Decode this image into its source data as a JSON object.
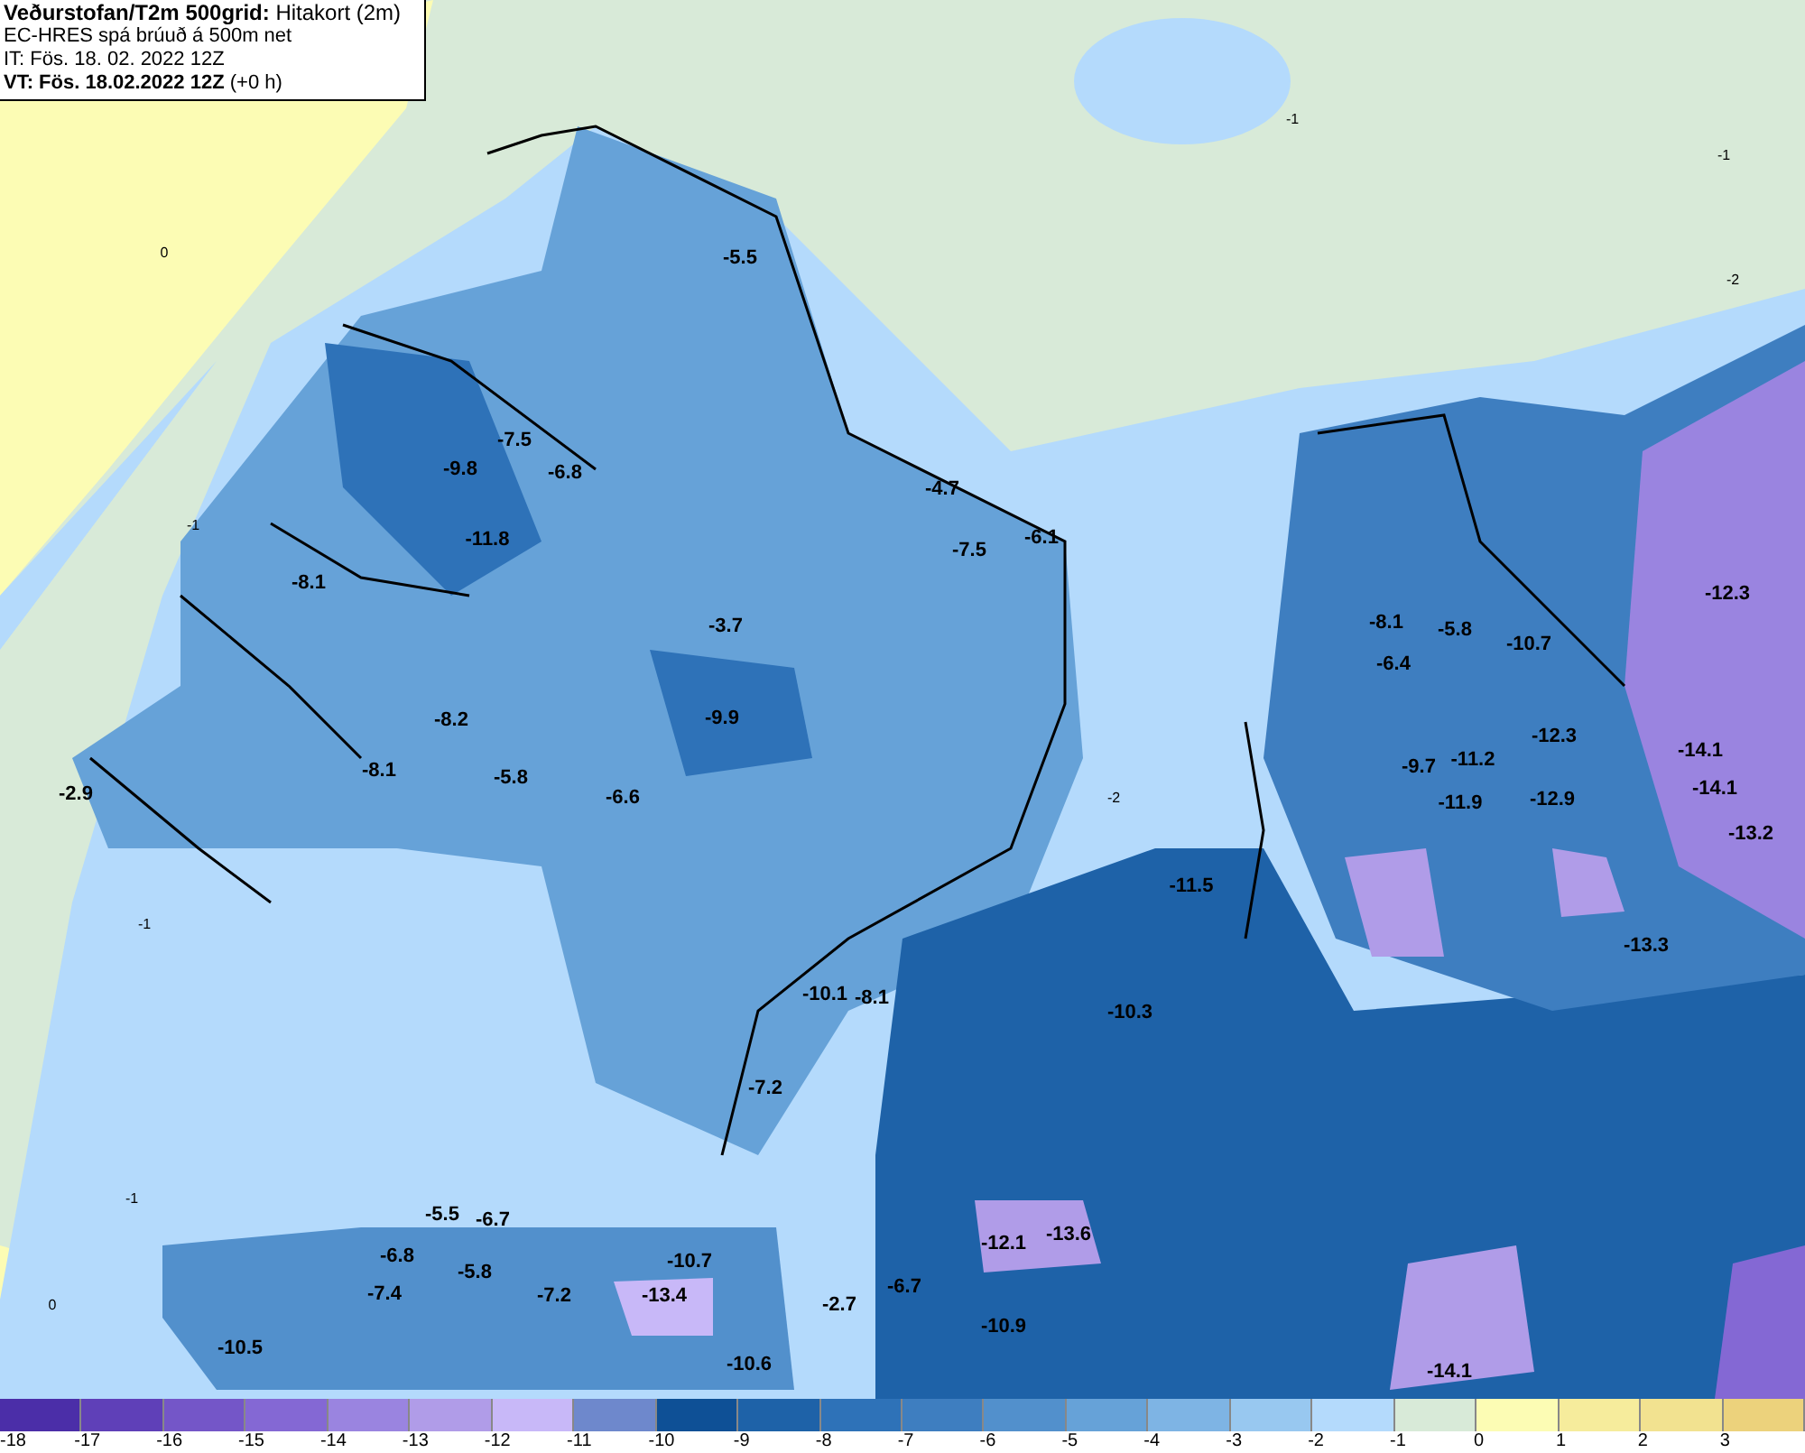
{
  "header": {
    "lines": [
      "**Veðurstofan/T2m 500grid:** Hitakort (2m)",
      "EC-HRES spá brúuð á 500m net",
      "IT: Fös. 18. 02. 2022 12Z",
      "**VT: Fös. 18.02.2022 12Z** (+0 h)"
    ]
  },
  "map": {
    "peak_labels": [
      "-5.5",
      "-7.5",
      "-9.8",
      "-6.8",
      "-11.8",
      "-8.1",
      "-3.7",
      "-4.7",
      "-7.5",
      "-6.1",
      "-8.2",
      "-8.1",
      "-9.9",
      "-2.9",
      "-5.8",
      "-6.6",
      "-11.5",
      "-10.1",
      "-8.1",
      "-10.3",
      "-7.2",
      "-8.1",
      "-5.8",
      "-6.4",
      "-10.7",
      "-12.3",
      "-12.3",
      "-9.7",
      "-11.2",
      "-11.9",
      "-12.9",
      "-14.1",
      "-14.1",
      "-13.2",
      "-13.3",
      "-5.5",
      "-6.7",
      "-6.8",
      "-5.8",
      "-7.4",
      "-7.2",
      "-10.7",
      "-13.4",
      "-10.5",
      "-2.7",
      "-6.7",
      "-10.6",
      "-12.1",
      "-13.6",
      "-10.9",
      "-14.1"
    ],
    "contour_labels": [
      "0",
      "-1",
      "-1",
      "-1",
      "-2",
      "-1",
      "-1",
      "0",
      "-2"
    ]
  },
  "legend": [
    {
      "label": "-18",
      "color": "#4b2ea8"
    },
    {
      "label": "-17",
      "color": "#5f40b8"
    },
    {
      "label": "-16",
      "color": "#7456c8"
    },
    {
      "label": "-15",
      "color": "#8468d4"
    },
    {
      "label": "-14",
      "color": "#9a84e0"
    },
    {
      "label": "-13",
      "color": "#b09ce8"
    },
    {
      "label": "-12",
      "color": "#c8b8f8"
    },
    {
      "label": "-11",
      "color": "#6e88cc"
    },
    {
      "label": "-10",
      "color": "#0e5096"
    },
    {
      "label": "-9",
      "color": "#1e62a8"
    },
    {
      "label": "-8",
      "color": "#2e72b8"
    },
    {
      "label": "-7",
      "color": "#3e7ec0"
    },
    {
      "label": "-6",
      "color": "#5290cc"
    },
    {
      "label": "-5",
      "color": "#66a2d8"
    },
    {
      "label": "-4",
      "color": "#7eb4e4"
    },
    {
      "label": "-3",
      "color": "#98c8f0"
    },
    {
      "label": "-2",
      "color": "#b4dafc"
    },
    {
      "label": "-1",
      "color": "#d8ead8"
    },
    {
      "label": "0",
      "color": "#fcfcb4"
    },
    {
      "label": "1",
      "color": "#f6ec9c"
    },
    {
      "label": "2",
      "color": "#f2e290"
    },
    {
      "label": "3",
      "color": "#ecd27c"
    }
  ]
}
